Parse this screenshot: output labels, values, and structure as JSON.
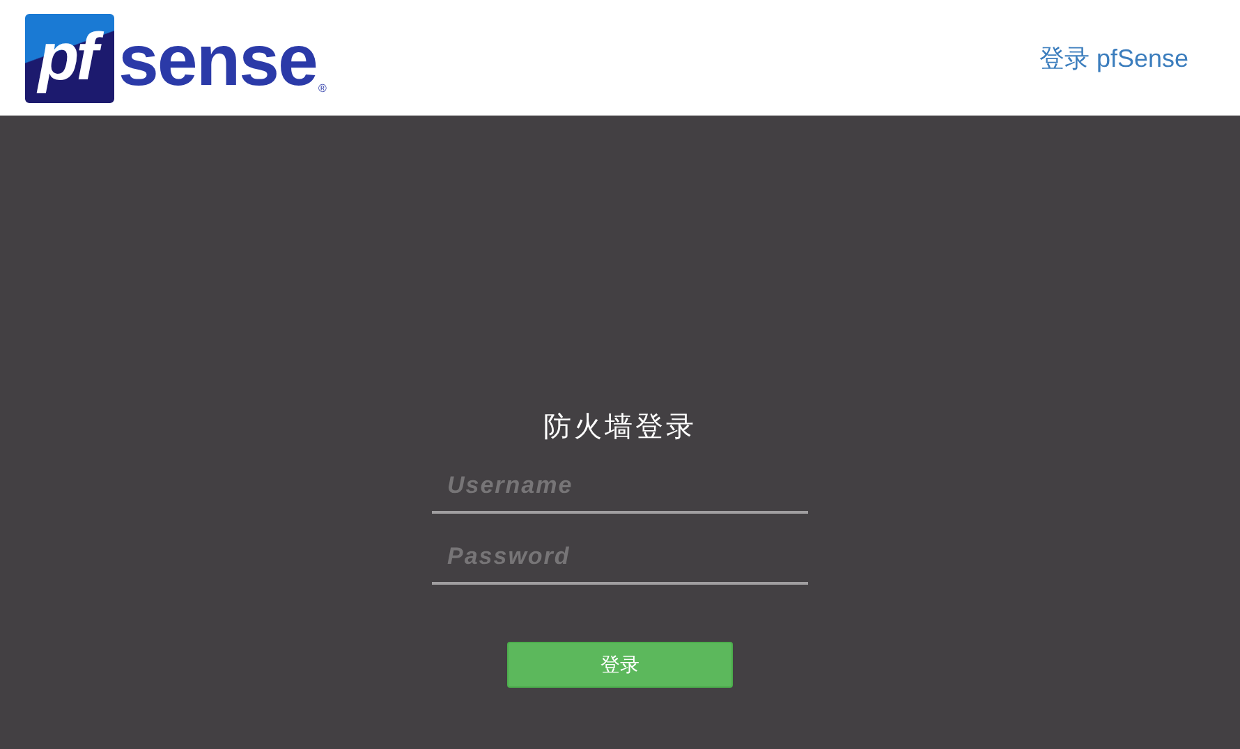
{
  "header": {
    "logo": {
      "mark": "pf",
      "word": "sense",
      "registered": "®"
    },
    "title": "登录 pfSense"
  },
  "login": {
    "heading": "防火墙登录",
    "fields": [
      {
        "placeholder": "Username"
      },
      {
        "placeholder": "Password"
      }
    ],
    "button": "登录"
  }
}
